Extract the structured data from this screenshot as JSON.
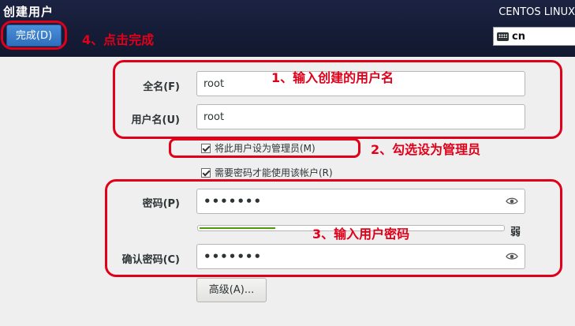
{
  "header": {
    "title": "创建用户",
    "product": "CENTOS LINUX",
    "done_label": "完成(D)",
    "keyboard_layout": "cn",
    "keyboard_icon": "keyboard-icon"
  },
  "form": {
    "fullname_label": "全名(F)",
    "fullname_value": "root",
    "username_label": "用户名(U)",
    "username_value": "root",
    "admin_checkbox": {
      "label": "将此用户设为管理员(M)",
      "checked": true
    },
    "require_pw_checkbox": {
      "label": "需要密码才能使用该帐户(R)",
      "checked": true
    },
    "password_label": "密码(P)",
    "password_value": "•••••••",
    "confirm_label": "确认密码(C)",
    "confirm_value": "•••••••",
    "strength": {
      "label": "弱",
      "level": 0.25,
      "color": "#4e9a06"
    },
    "advanced_label": "高级(A)..."
  },
  "annotations": {
    "color": "#e0001a",
    "step1": "1、输入创建的用户名",
    "step2": "2、勾选设为管理员",
    "step3": "3、输入用户密码",
    "step4": "4、点击完成"
  }
}
